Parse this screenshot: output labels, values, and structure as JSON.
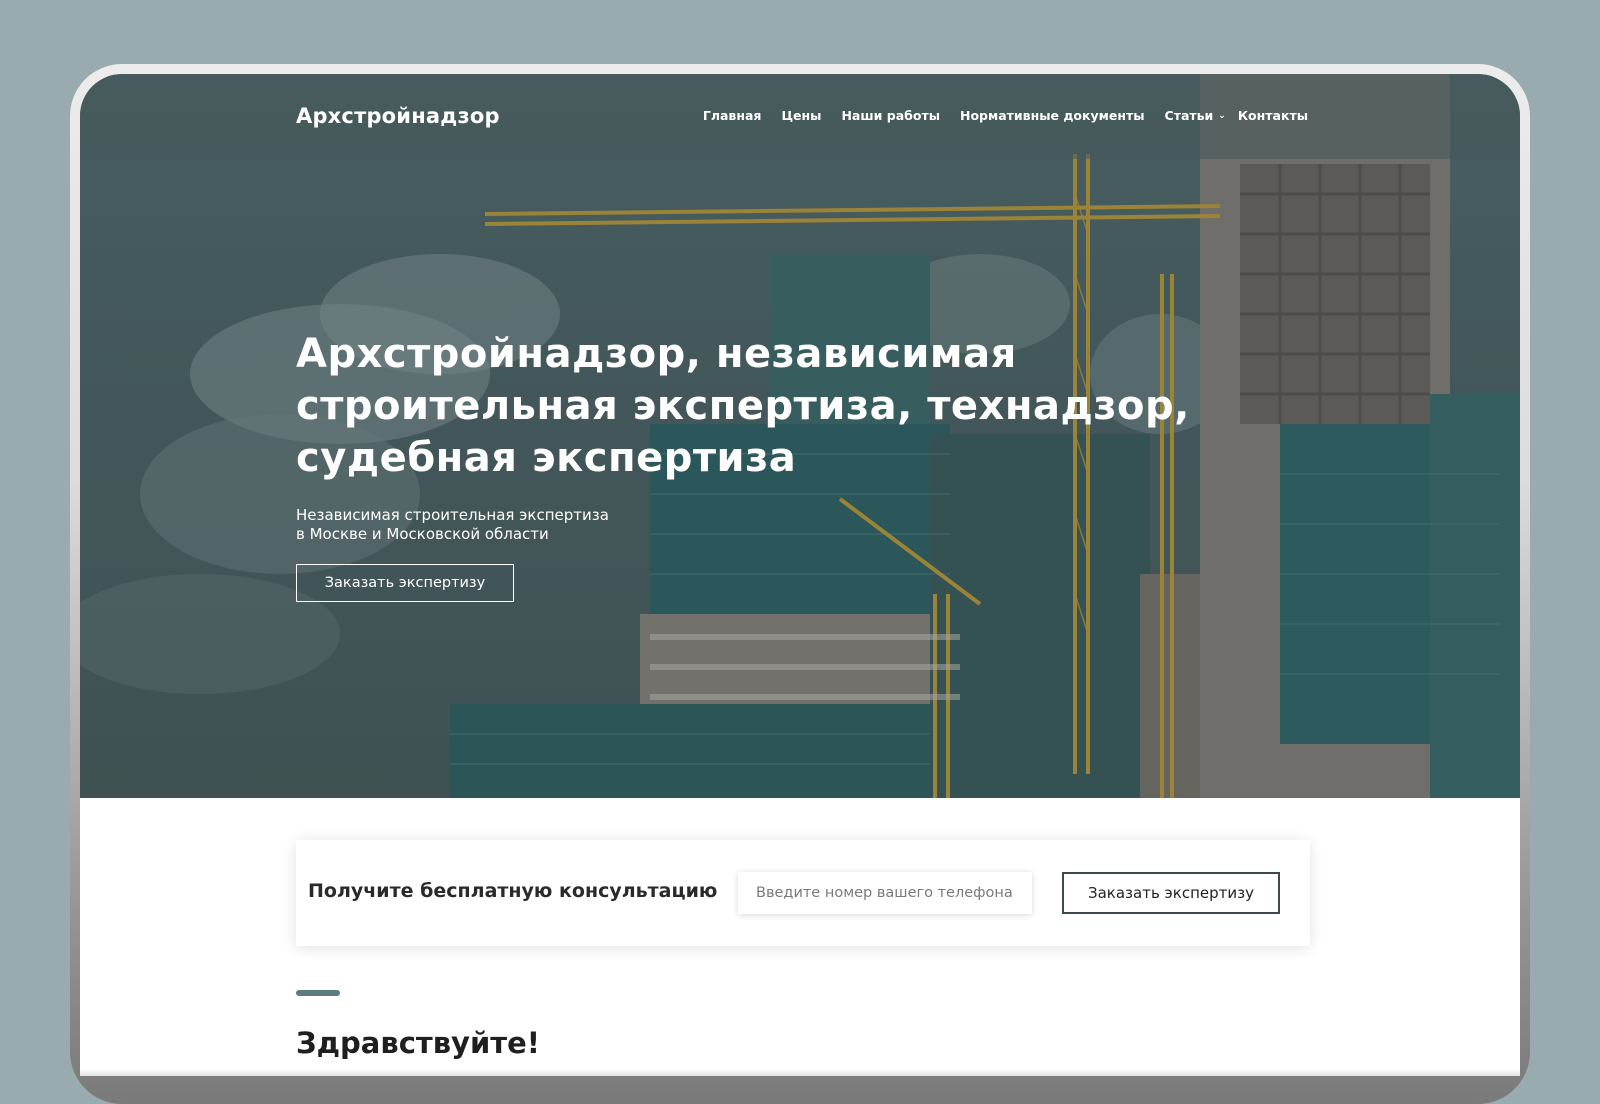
{
  "site": {
    "logo": "Архстройнадзор"
  },
  "nav": {
    "items": [
      {
        "label": "Главная"
      },
      {
        "label": "Цены"
      },
      {
        "label": "Наши работы"
      },
      {
        "label": "Нормативные документы"
      },
      {
        "label": "Статьи"
      },
      {
        "label": "Контакты"
      }
    ]
  },
  "hero": {
    "title_lines": [
      "Архстройнадзор, независимая",
      "строительная экспертиза, технадзор,",
      "судебная экспертиза"
    ],
    "subtitle_lines": [
      "Независимая строительная экспертиза",
      "в Москве и Московской области"
    ],
    "cta_label": "Заказать экспертизу"
  },
  "consult": {
    "label": "Получите бесплатную консультацию",
    "phone_placeholder": "Введите номер вашего телефона",
    "button_label": "Заказать экспертизу"
  },
  "greeting": {
    "title": "Здравствуйте!"
  },
  "colors": {
    "page_background": "#9aabb0",
    "hero_tint": "#4f686b",
    "accent": "#5e7b7f",
    "crane": "#c8a23a"
  }
}
